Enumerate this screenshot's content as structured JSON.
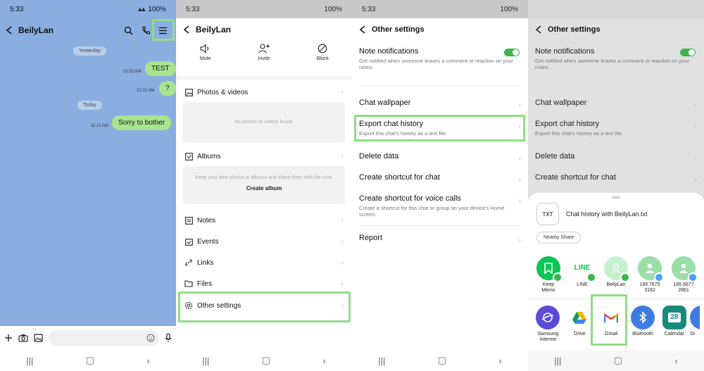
{
  "status": {
    "time": "5:33",
    "battery": "100%"
  },
  "panel1": {
    "chat_title": "BeilyLan",
    "date_chip_1": "Yesterday",
    "date_chip_2": "Today",
    "messages": [
      {
        "text": "TEST",
        "time": "10:22 AM"
      },
      {
        "text": "?",
        "time": "10:22 AM"
      },
      {
        "text": "Sorry to bother",
        "time": "11:12 AM"
      }
    ]
  },
  "panel2": {
    "title": "BeilyLan",
    "actions": {
      "mute": "Mute",
      "invite": "Invite",
      "block": "Block"
    },
    "photos_label": "Photos & videos",
    "no_photos": "No photos or videos found.",
    "albums_label": "Albums",
    "albums_hint": "Keep your best photos in albums and share them with the chat.",
    "create_album": "Create album",
    "notes_label": "Notes",
    "events_label": "Events",
    "links_label": "Links",
    "files_label": "Files",
    "other_settings_label": "Other settings"
  },
  "panel3": {
    "title": "Other settings",
    "note_notifications": "Note notifications",
    "note_notifications_sub": "Get notified when someone leaves a comment or reaction on your notes.",
    "chat_wallpaper": "Chat wallpaper",
    "export_chat": "Export chat history",
    "export_chat_sub": "Export this chat's history as a text file.",
    "delete_data": "Delete data",
    "create_shortcut": "Create shortcut for chat",
    "create_shortcut_voice": "Create shortcut for voice calls",
    "create_shortcut_voice_sub": "Create a shortcut for this chat or group on your device's Home screen.",
    "report": "Report"
  },
  "panel4": {
    "title": "Other settings",
    "note_notifications": "Note notifications",
    "note_notifications_sub": "Get notified when someone leaves a comment or reaction on your notes.",
    "chat_wallpaper": "Chat wallpaper",
    "export_chat": "Export chat history",
    "export_chat_sub": "Export this chat's history as a text file.",
    "delete_data": "Delete data",
    "create_shortcut": "Create shortcut for chat",
    "file_type": "TXT",
    "file_name": "Chat history with BeilyLan.txt",
    "nearby_share": "Nearby Share",
    "apps_row1": [
      {
        "label": "Keep\nMemo",
        "color": "#06c755"
      },
      {
        "label": "LINE",
        "color": "#ffffff"
      },
      {
        "label": "BeilyLan",
        "color": "#c8eed0"
      },
      {
        "label": "199 7675\n3162",
        "color": "#9adfa9"
      },
      {
        "label": "185 6677\n2861",
        "color": "#9adfa9"
      }
    ],
    "apps_row2": [
      {
        "label": "Samsung\nInternet",
        "color": "#5b4bd6"
      },
      {
        "label": "Drive",
        "color": "#ffffff"
      },
      {
        "label": "Gmail",
        "color": "#ffffff"
      },
      {
        "label": "Bluetooth",
        "color": "#3d7be0"
      },
      {
        "label": "Calendar",
        "color": "#1a8a7a"
      },
      {
        "label": "Di",
        "color": "#3d7be0"
      }
    ],
    "calendar_day": "28",
    "line_logo": "LINE"
  }
}
